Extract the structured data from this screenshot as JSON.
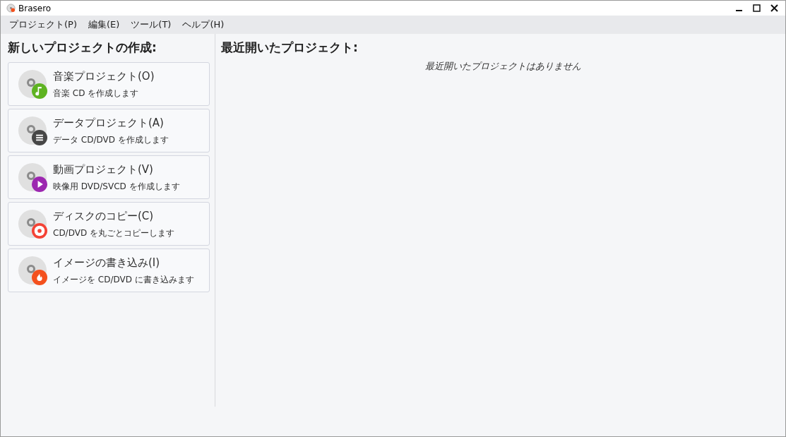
{
  "window": {
    "title": "Brasero"
  },
  "menu": [
    "プロジェクト(P)",
    "編集(E)",
    "ツール(T)",
    "ヘルプ(H)"
  ],
  "new_project": {
    "heading": "新しいプロジェクトの作成:",
    "items": [
      {
        "kind": "music",
        "color": "#5eb321",
        "title": "音楽プロジェクト(O)",
        "description": "音楽 CD を作成します"
      },
      {
        "kind": "data",
        "color": "#474747",
        "title": "データプロジェクト(A)",
        "description": "データ CD/DVD を作成します"
      },
      {
        "kind": "video",
        "color": "#9c27b0",
        "title": "動画プロジェクト(V)",
        "description": "映像用 DVD/SVCD を作成します"
      },
      {
        "kind": "copy",
        "color": "#f44336",
        "title": "ディスクのコピー(C)",
        "description": "CD/DVD を丸ごとコピーします"
      },
      {
        "kind": "image",
        "color": "#f4511e",
        "title": "イメージの書き込み(I)",
        "description": "イメージを CD/DVD に書き込みます"
      }
    ]
  },
  "recent": {
    "heading": "最近開いたプロジェクト:",
    "empty_message": "最近開いたプロジェクトはありません"
  }
}
